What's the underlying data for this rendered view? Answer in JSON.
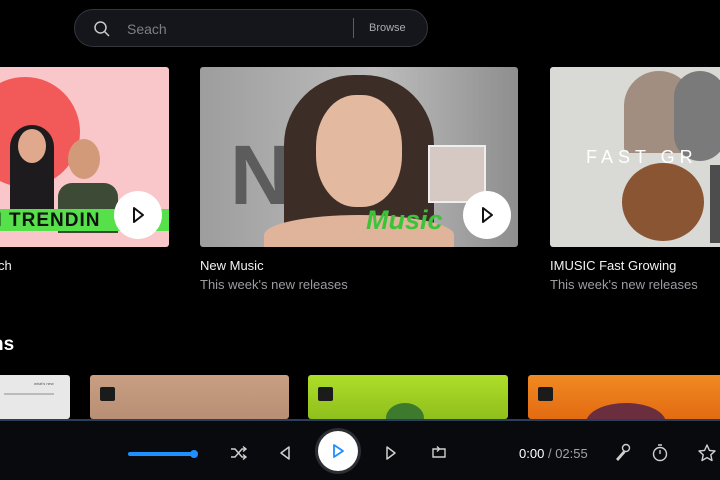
{
  "search": {
    "placeholder": "Seach",
    "browse_label": "Browse"
  },
  "playlists": [
    {
      "title": "ch",
      "subtitle": "",
      "cover_text": "N TRENDIN",
      "cover_bg": "#f9c7c9"
    },
    {
      "title": "New Music",
      "subtitle": "This week's new releases",
      "cover_text": "Music",
      "cover_letter": "N",
      "cover_bg": "#9a9a9a"
    },
    {
      "title": "IMUSIC Fast Growing",
      "subtitle": "This week's new releases",
      "cover_text": "FAST GR",
      "cover_bg": "#d8d8d4"
    }
  ],
  "section": {
    "title": "ns"
  },
  "albums": [
    {
      "label": "what's new",
      "color": "#e8e8e8"
    },
    {
      "color": "#c39b80"
    },
    {
      "color": "#a3d12a"
    },
    {
      "color": "#f07c1a"
    }
  ],
  "player": {
    "progress": 0.0,
    "time_current": "0:00",
    "time_separator": "/",
    "time_total": "02:55",
    "accent": "#1e90ff"
  }
}
